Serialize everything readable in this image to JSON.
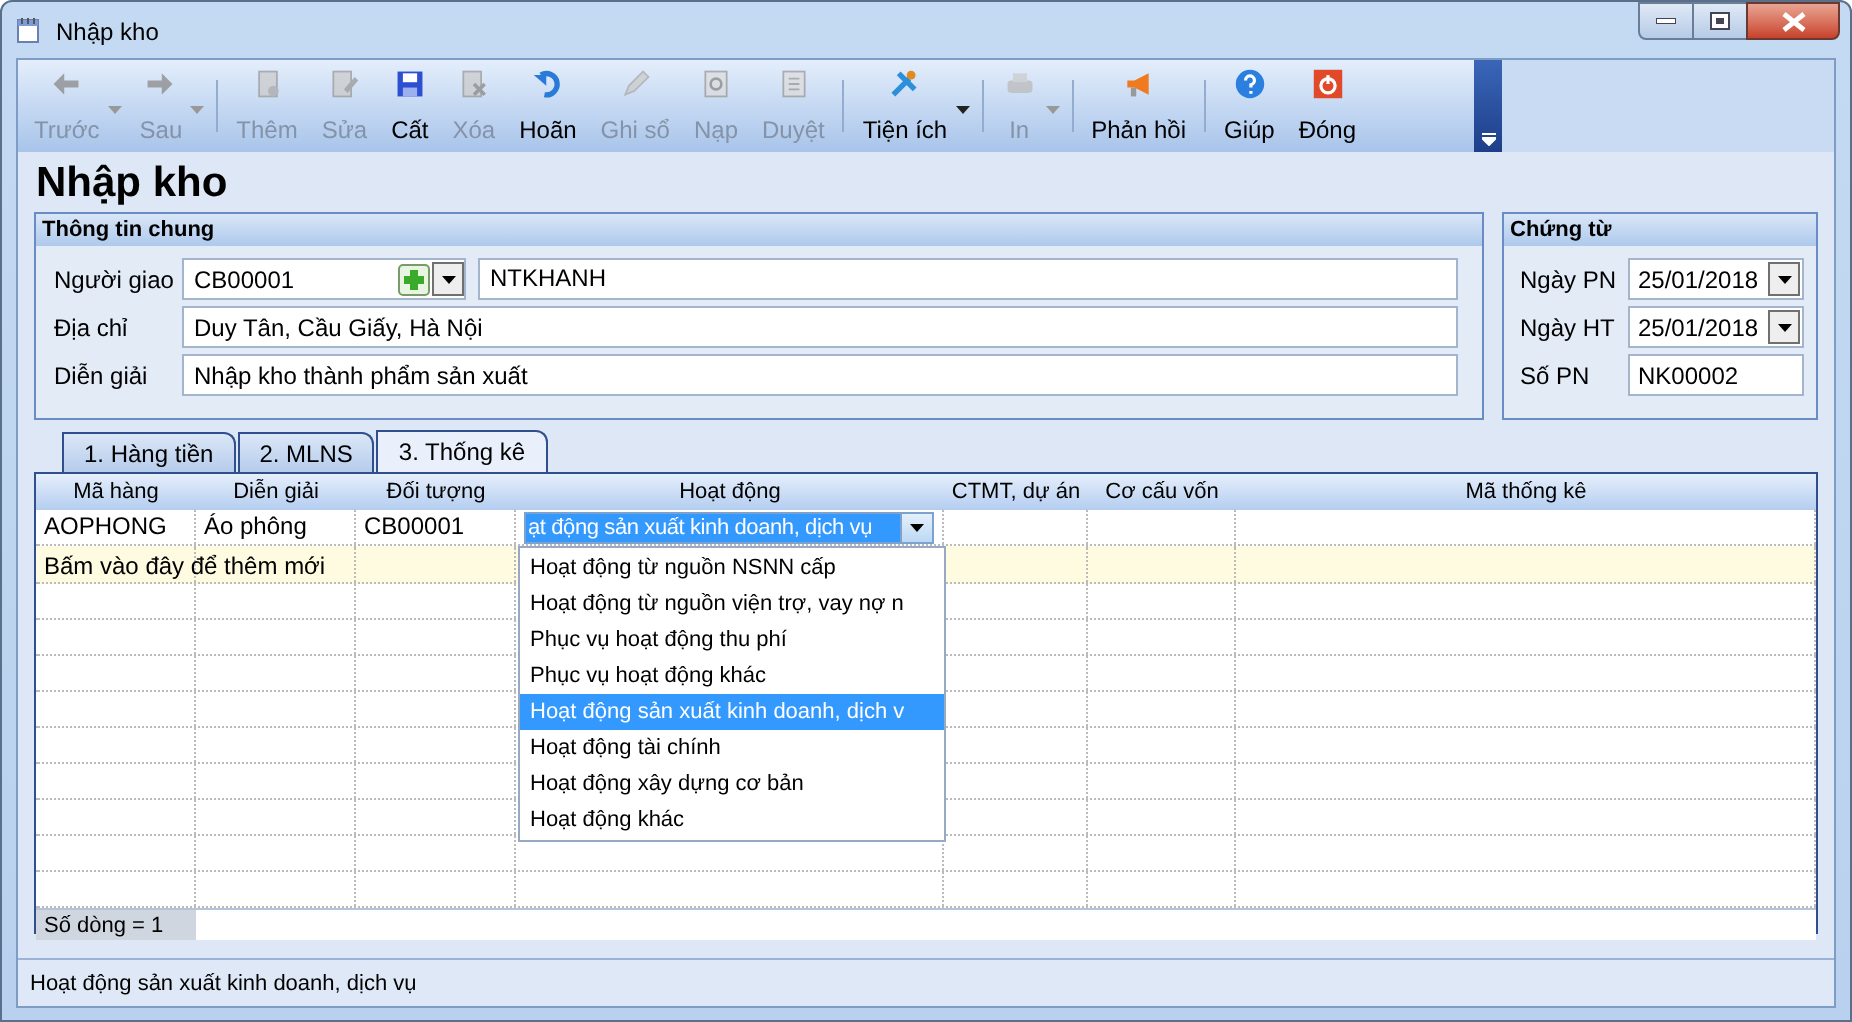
{
  "window": {
    "title": "Nhập kho"
  },
  "toolbar": {
    "groups": [
      [
        {
          "label": "Trước",
          "disabled": true,
          "dropdown": true
        },
        {
          "label": "Sau",
          "disabled": true,
          "dropdown": true
        }
      ],
      [
        {
          "label": "Thêm",
          "disabled": true,
          "dropdown": false
        },
        {
          "label": "Sửa",
          "disabled": true,
          "dropdown": false
        },
        {
          "label": "Cất",
          "disabled": false,
          "dropdown": false
        },
        {
          "label": "Xóa",
          "disabled": true,
          "dropdown": false
        },
        {
          "label": "Hoãn",
          "disabled": false,
          "dropdown": false
        },
        {
          "label": "Ghi sổ",
          "disabled": true,
          "dropdown": false
        },
        {
          "label": "Nạp",
          "disabled": true,
          "dropdown": false
        },
        {
          "label": "Duyệt",
          "disabled": true,
          "dropdown": false
        }
      ],
      [
        {
          "label": "Tiện ích",
          "disabled": false,
          "dropdown": true
        }
      ],
      [
        {
          "label": "In",
          "disabled": true,
          "dropdown": true
        }
      ],
      [
        {
          "label": "Phản hồi",
          "disabled": false,
          "dropdown": false
        }
      ],
      [
        {
          "label": "Giúp",
          "disabled": false,
          "dropdown": false
        },
        {
          "label": "Đóng",
          "disabled": false,
          "dropdown": false
        }
      ]
    ]
  },
  "heading": "Nhập kho",
  "general": {
    "title": "Thông tin chung",
    "deliverer": {
      "label": "Người giao",
      "code": "CB00001",
      "name": "NTKHANH"
    },
    "address": {
      "label": "Địa chỉ",
      "value": "Duy Tân, Cầu Giấy, Hà Nội"
    },
    "description": {
      "label": "Diễn giải",
      "value": "Nhập kho thành phẩm sản xuất"
    }
  },
  "voucher": {
    "title": "Chứng từ",
    "fields": [
      {
        "kind": "date",
        "label": "Ngày PN",
        "value": "25/01/2018"
      },
      {
        "kind": "date",
        "label": "Ngày HT",
        "value": "25/01/2018"
      },
      {
        "kind": "text",
        "label": "Số PN",
        "value": "NK00002"
      }
    ]
  },
  "tabs": [
    {
      "label": "1. Hàng tiền",
      "selected": false
    },
    {
      "label": "2. MLNS",
      "selected": false
    },
    {
      "label": "3. Thống kê",
      "selected": true
    }
  ],
  "table": {
    "columns": [
      "Mã hàng",
      "Diễn giải",
      "Đối tượng",
      "Hoạt động",
      "CTMT, dự án",
      "Cơ cấu vốn",
      "Mã thống kê"
    ],
    "rows": [
      [
        "AOPHONG",
        "Áo phông",
        "CB00001",
        "ạt động sản xuất kinh doanh, dịch vụ",
        "",
        "",
        ""
      ]
    ],
    "new_row": "Bấm vào đây để thêm mới",
    "footer": "Số dòng = 1"
  },
  "dropdown": {
    "items": [
      {
        "label": "Hoạt động từ nguồn NSNN cấp",
        "selected": false
      },
      {
        "label": "Hoạt động từ nguồn viện trợ, vay nợ n",
        "selected": false
      },
      {
        "label": "Phục vụ hoạt động thu phí",
        "selected": false
      },
      {
        "label": "Phục vụ hoạt động khác",
        "selected": false
      },
      {
        "label": "Hoạt động sản xuất kinh doanh, dịch v",
        "selected": true
      },
      {
        "label": "Hoạt động tài chính",
        "selected": false
      },
      {
        "label": "Hoạt động xây dựng cơ bản",
        "selected": false
      },
      {
        "label": "Hoạt động khác",
        "selected": false
      }
    ]
  },
  "status_bar": "Hoạt động sản xuất kinh doanh, dịch vụ"
}
